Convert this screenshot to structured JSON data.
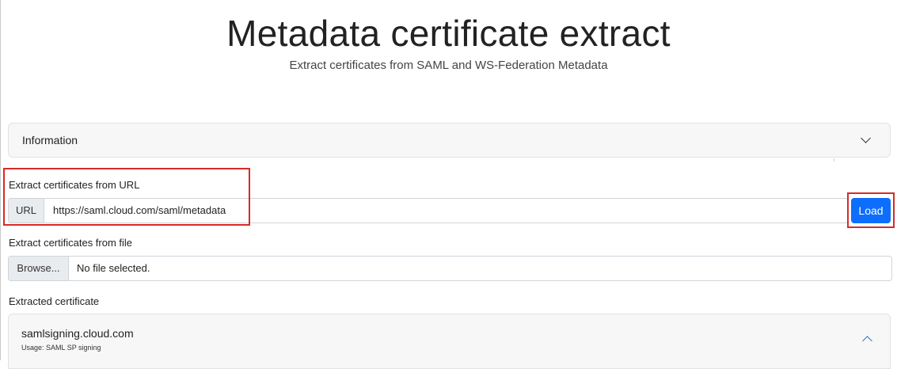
{
  "header": {
    "title": "Metadata certificate extract",
    "subtitle": "Extract certificates from SAML and WS-Federation Metadata"
  },
  "info_accordion": {
    "label": "Information",
    "icon": "chevron-down-icon",
    "expanded": false
  },
  "url_section": {
    "label": "Extract certificates from URL",
    "addon": "URL",
    "value": "https://saml.cloud.com/saml/metadata",
    "button_label": "Load",
    "button_color": "#0d6efd"
  },
  "file_section": {
    "label": "Extract certificates from file",
    "browse_label": "Browse...",
    "status": "No file selected."
  },
  "extracted_section": {
    "label": "Extracted certificate",
    "certificate": {
      "name": "samlsigning.cloud.com",
      "usage": "Usage: SAML SP signing",
      "icon": "chevron-up-icon",
      "expanded": true
    }
  },
  "annotations": {
    "highlight_color": "#d72a2a"
  }
}
